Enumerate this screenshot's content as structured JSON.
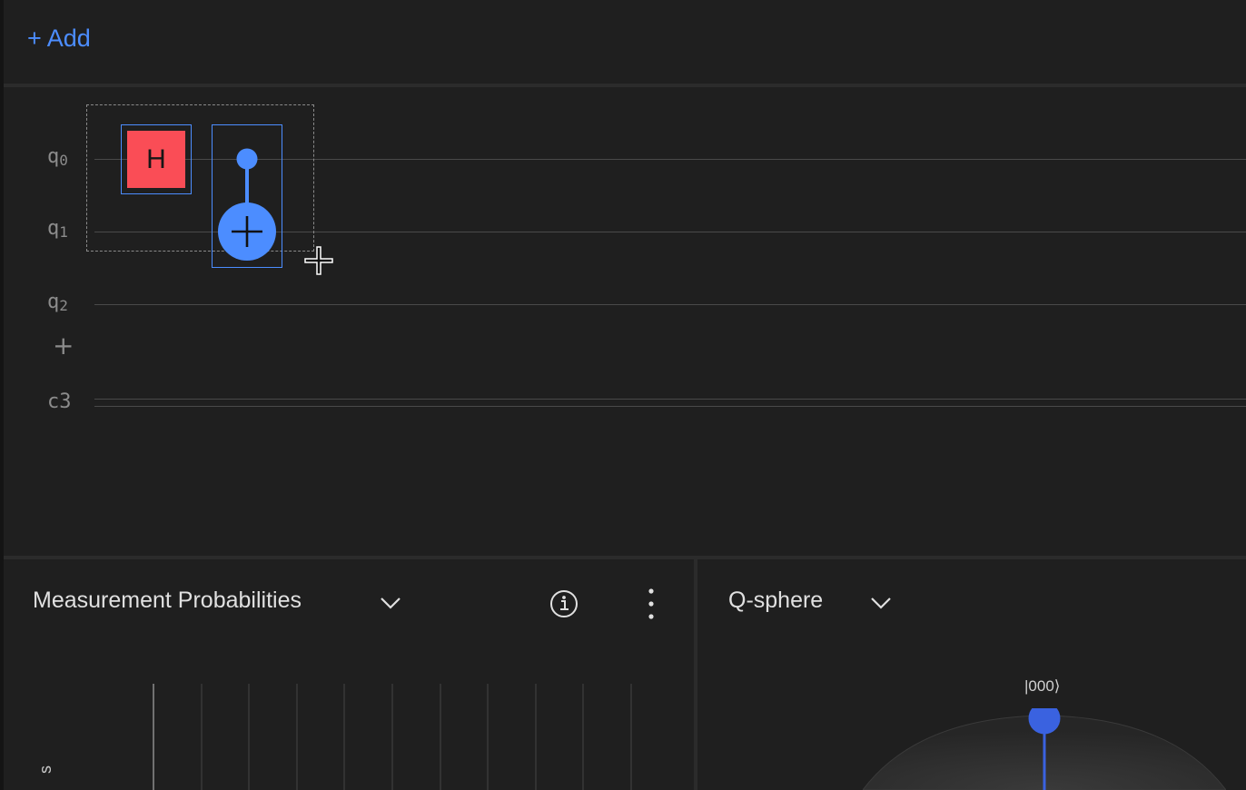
{
  "toolbar": {
    "add_label": "+ Add"
  },
  "circuit": {
    "qubits": [
      {
        "name": "q",
        "index": "0"
      },
      {
        "name": "q",
        "index": "1"
      },
      {
        "name": "q",
        "index": "2"
      }
    ],
    "add_qubit": "+",
    "classical": {
      "label": "c3"
    },
    "gates": {
      "h_label": "H"
    }
  },
  "panels": {
    "probabilities": {
      "title": "Measurement Probabilities",
      "axis_letter": "s"
    },
    "qsphere": {
      "title": "Q-sphere",
      "state_label": "|000⟩"
    }
  },
  "colors": {
    "accent": "#4c8dff",
    "h_gate": "#fa4d56",
    "background": "#1f1f1f",
    "qsphere_node": "#3a62e0"
  }
}
